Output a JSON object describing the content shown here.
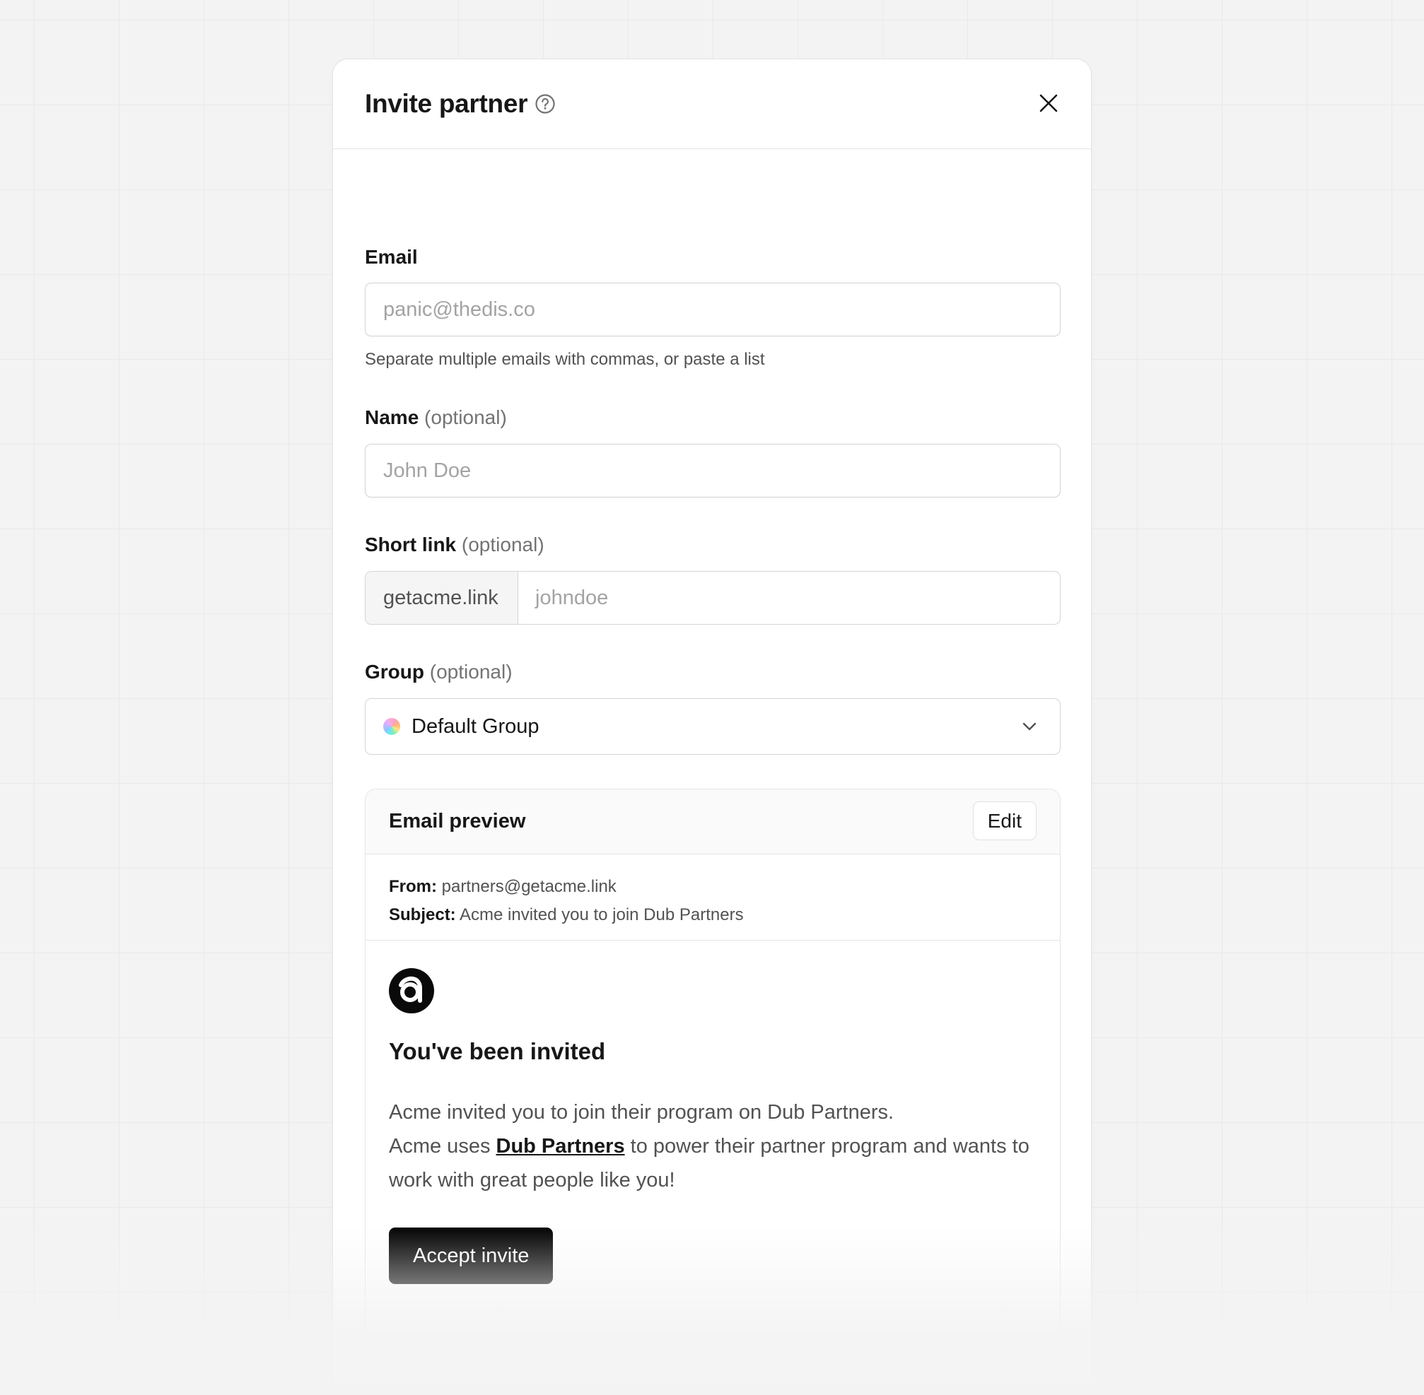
{
  "modal": {
    "title": "Invite partner",
    "help_icon": "help-circle-icon",
    "close_icon": "close-icon"
  },
  "email": {
    "label": "Email",
    "placeholder": "panic@thedis.co",
    "helper": "Separate multiple emails with commas, or paste a list"
  },
  "name": {
    "label": "Name",
    "optional": "(optional)",
    "placeholder": "John Doe"
  },
  "short_link": {
    "label": "Short link",
    "optional": "(optional)",
    "prefix": "getacme.link",
    "placeholder": "johndoe"
  },
  "group": {
    "label": "Group",
    "optional": "(optional)",
    "selected": "Default Group",
    "chevron_icon": "chevron-down-icon"
  },
  "preview": {
    "title": "Email preview",
    "edit_label": "Edit",
    "from_label": "From:",
    "from_value": "partners@getacme.link",
    "subject_label": "Subject:",
    "subject_value": "Acme invited you to join Dub Partners",
    "logo_icon": "acme-logo-icon",
    "heading": "You've been invited",
    "line1": "Acme invited you to join their program on Dub Partners.",
    "line2_pre": "Acme uses ",
    "line2_link": "Dub Partners",
    "line2_post": " to power their partner program and wants to work with great people like you!",
    "accept_label": "Accept invite"
  },
  "colors": {
    "background": "#f3f3f3",
    "primary_button": "#000000",
    "text": "#171717",
    "muted": "#525252"
  }
}
